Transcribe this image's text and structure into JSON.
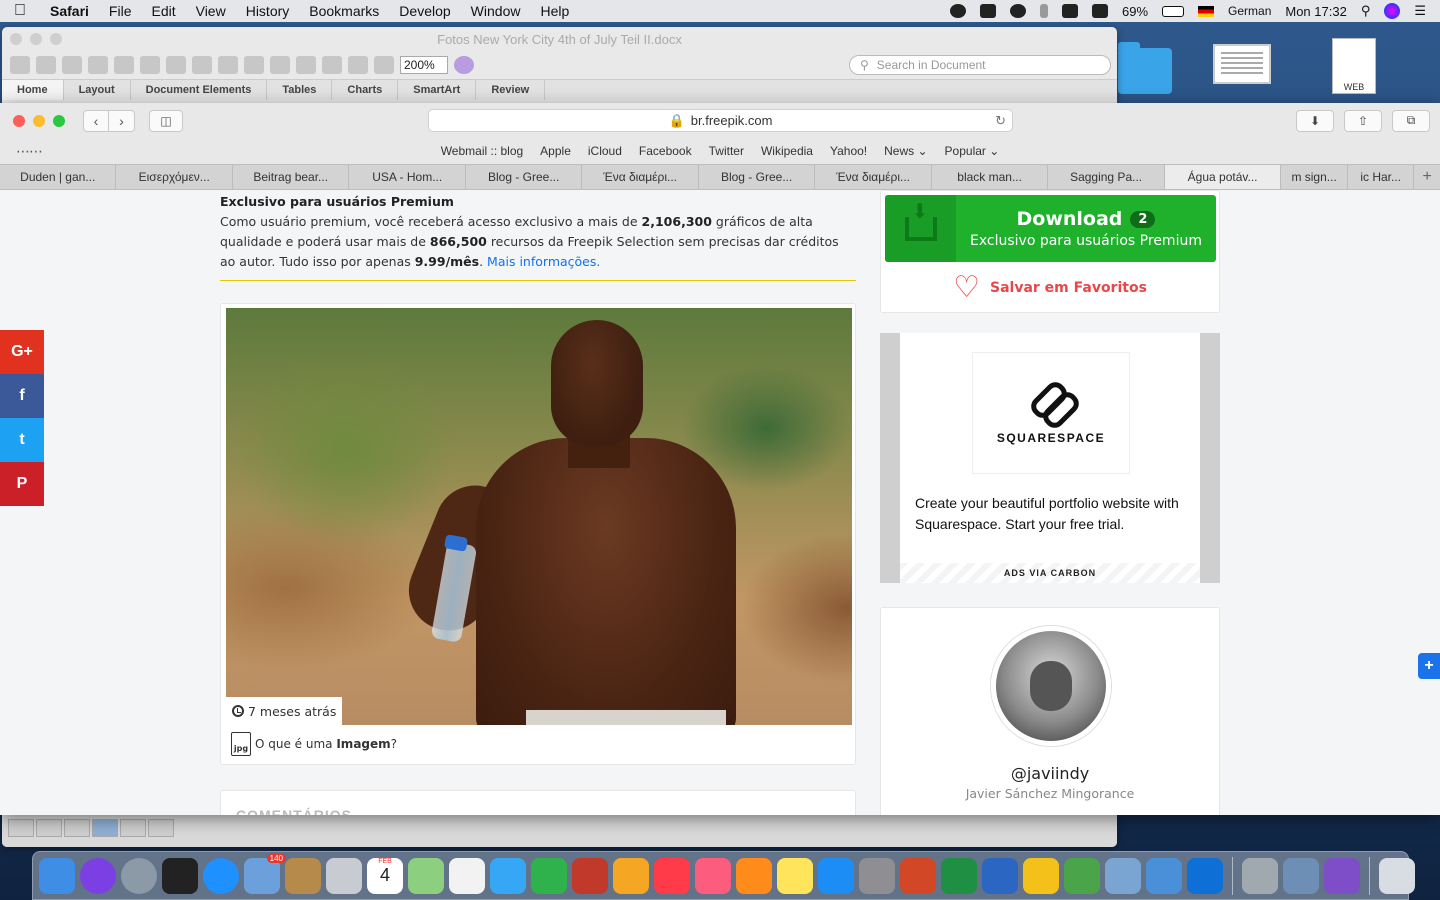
{
  "menubar": {
    "app": "Safari",
    "items": [
      "File",
      "Edit",
      "View",
      "History",
      "Bookmarks",
      "Develop",
      "Window",
      "Help"
    ],
    "battery": "69%",
    "input_source": "German",
    "clock": "Mon 17:32"
  },
  "desktop": {
    "doc_label": "WEB"
  },
  "word": {
    "title": "Fotos New York City 4th of July Teil II.docx",
    "zoom": "200%",
    "search_placeholder": "Search in Document",
    "ribbon_tabs": [
      "Home",
      "Layout",
      "Document Elements",
      "Tables",
      "Charts",
      "SmartArt",
      "Review"
    ]
  },
  "safari": {
    "url": "br.freepik.com",
    "bookmarks": [
      "Webmail :: blog",
      "Apple",
      "iCloud",
      "Facebook",
      "Twitter",
      "Wikipedia",
      "Yahoo!",
      "News ⌄",
      "Popular ⌄"
    ],
    "tabs": [
      "Duden | gan...",
      "Εισερχόμεν...",
      "Beitrag bear...",
      "USA - Hom...",
      "Blog - Gree...",
      "Ένα διαμέρι...",
      "Blog - Gree...",
      "Ένα διαμέρι...",
      "black man...",
      "Sagging Pa...",
      "Água potáv...",
      "m sign...",
      "ic Har..."
    ],
    "active_tab_index": 10
  },
  "share": {
    "google": "G+",
    "facebook": "f",
    "twitter": "t",
    "pinterest": "P",
    "float": "+"
  },
  "premium": {
    "title": "Exclusivo para usuários Premium",
    "line_a": "Como usuário premium, você receberá acesso exclusivo a mais de ",
    "count1": "2,106,300",
    "line_b": " gráficos de alta qualidade e poderá usar mais de ",
    "count2": "866,500",
    "line_c": " recursos da Freepik Selection sem precisas dar créditos ao autor. Tudo isso por apenas ",
    "price": "9.99/mês",
    "line_d": ". ",
    "more": "Mais informações."
  },
  "image": {
    "time": "7 meses atrás",
    "file_icon": "jpg",
    "info_a": "O que é uma ",
    "info_b": "Imagem",
    "info_c": "?"
  },
  "comments": {
    "title": "COMENTÁRIOS"
  },
  "download": {
    "label": "Download",
    "count": "2",
    "sub": "Exclusivo para usuários Premium",
    "favorite": "Salvar em Favoritos"
  },
  "ad": {
    "brand": "SQUARESPACE",
    "text": "Create your beautiful portfolio website with Squarespace. Start your free trial.",
    "via": "ADS VIA CARBON"
  },
  "author": {
    "handle": "@javiindy",
    "name": "Javier Sánchez Mingorance"
  },
  "dock": {
    "mail_badge": "140",
    "calendar_month": "FEB",
    "calendar_day": "4",
    "apps": [
      {
        "name": "finder",
        "color": "#3e8ee6"
      },
      {
        "name": "siri",
        "color": "#7b3fe4"
      },
      {
        "name": "launchpad",
        "color": "#8c9aa8"
      },
      {
        "name": "photo-booth",
        "color": "#222222"
      },
      {
        "name": "safari",
        "color": "#1e90ff"
      },
      {
        "name": "mail",
        "color": "#6ca0dc"
      },
      {
        "name": "notes-book",
        "color": "#b58a4b"
      },
      {
        "name": "help",
        "color": "#c8ccd2"
      },
      {
        "name": "calendar",
        "color": "#ffffff"
      },
      {
        "name": "maps",
        "color": "#8ccf7e"
      },
      {
        "name": "reminders",
        "color": "#f2f2f2"
      },
      {
        "name": "messages",
        "color": "#35a7f5"
      },
      {
        "name": "facetime",
        "color": "#2fb24b"
      },
      {
        "name": "photo-tools",
        "color": "#c0392b"
      },
      {
        "name": "photos",
        "color": "#f5a623"
      },
      {
        "name": "news",
        "color": "#ff3b4a"
      },
      {
        "name": "music",
        "color": "#fc5c7d"
      },
      {
        "name": "books",
        "color": "#ff8c1a"
      },
      {
        "name": "stickies",
        "color": "#ffe45c"
      },
      {
        "name": "app-store",
        "color": "#1c8df5"
      },
      {
        "name": "system-preferences",
        "color": "#8e8e93"
      },
      {
        "name": "powerpoint",
        "color": "#d24726"
      },
      {
        "name": "excel",
        "color": "#1f8f44"
      },
      {
        "name": "word",
        "color": "#2b66c2"
      },
      {
        "name": "ring-app",
        "color": "#f4c11a"
      },
      {
        "name": "globe-app",
        "color": "#4aa44a"
      },
      {
        "name": "network-app",
        "color": "#7aa5d2"
      },
      {
        "name": "people-app",
        "color": "#4a90d9"
      },
      {
        "name": "teamviewer",
        "color": "#0e6fd6"
      },
      {
        "name": "automator",
        "color": "#a0a8b0"
      },
      {
        "name": "preview",
        "color": "#6d8fb6"
      },
      {
        "name": "viber",
        "color": "#7d4ec7"
      },
      {
        "name": "trash",
        "color": "#d8dde3"
      }
    ]
  }
}
